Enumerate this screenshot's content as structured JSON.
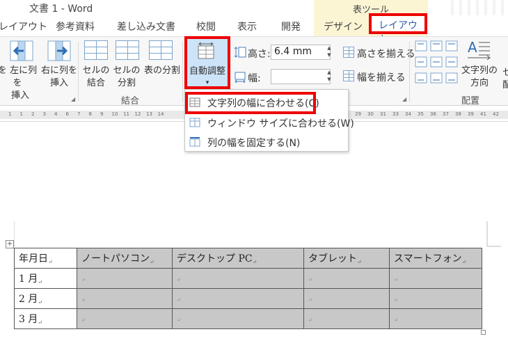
{
  "window": {
    "title": "文書 1 - Word",
    "context_group": "表ツール"
  },
  "tabs": [
    {
      "label": "レイアウト"
    },
    {
      "label": "参考資料"
    },
    {
      "label": "差し込み文書"
    },
    {
      "label": "校閲"
    },
    {
      "label": "表示"
    },
    {
      "label": "開発"
    },
    {
      "label": "デザイン"
    },
    {
      "label": "レイアウト",
      "active": true
    }
  ],
  "ribbon": {
    "insert_left_top": "左に列を",
    "insert_left_bottom": "挿入",
    "insert_right_top": "右に列を",
    "insert_right_bottom": "挿入",
    "cut_left_glyph": "を",
    "cut_left_bottom": "入",
    "merge_cells_top": "セルの",
    "merge_cells_bottom": "結合",
    "split_cells_top": "セルの",
    "split_cells_bottom": "分割",
    "split_table": "表の分割",
    "merge_group": "結合",
    "autofit": "自動調整",
    "autofit_arrow": "▾",
    "height_label": "高さ:",
    "height_value": "6.4 mm",
    "width_label": "幅:",
    "width_value": "",
    "distribute_rows": "高さを揃える",
    "distribute_cols": "幅を揃える",
    "text_direction_top": "文字列の",
    "text_direction_bottom": "方向",
    "align_group": "配置",
    "edge_glyph": "セ",
    "edge_glyph2": "配"
  },
  "dropdown": {
    "items": [
      {
        "label": "文字列の幅に合わせる(C)"
      },
      {
        "label": "ウィンドウ サイズに合わせる(W)"
      },
      {
        "label": "列の幅を固定する(N)"
      }
    ]
  },
  "ruler": {
    "left_numbers": [
      "1",
      "1",
      "2",
      "3",
      "4",
      "6",
      "7",
      "8",
      "9",
      "10",
      "11",
      "12",
      "13",
      "14"
    ],
    "right_numbers": [
      "29",
      "30",
      "31",
      "33",
      "34",
      "35",
      "36",
      "37",
      "38",
      "39",
      "41",
      "42"
    ]
  },
  "table": {
    "headers": [
      "年月日",
      "ノートパソコン",
      "デスクトップ PC",
      "タブレット",
      "スマートフォン"
    ],
    "rows": [
      [
        "1 月",
        "",
        "",
        "",
        ""
      ],
      [
        "2 月",
        "",
        "",
        "",
        ""
      ],
      [
        "3 月",
        "",
        "",
        "",
        ""
      ]
    ]
  },
  "colors": {
    "accent_red": "#e00000",
    "context_tab_bg": "#fcf5d4",
    "selected_button": "#cde3f7",
    "selected_cells": "#c8c8c8"
  }
}
